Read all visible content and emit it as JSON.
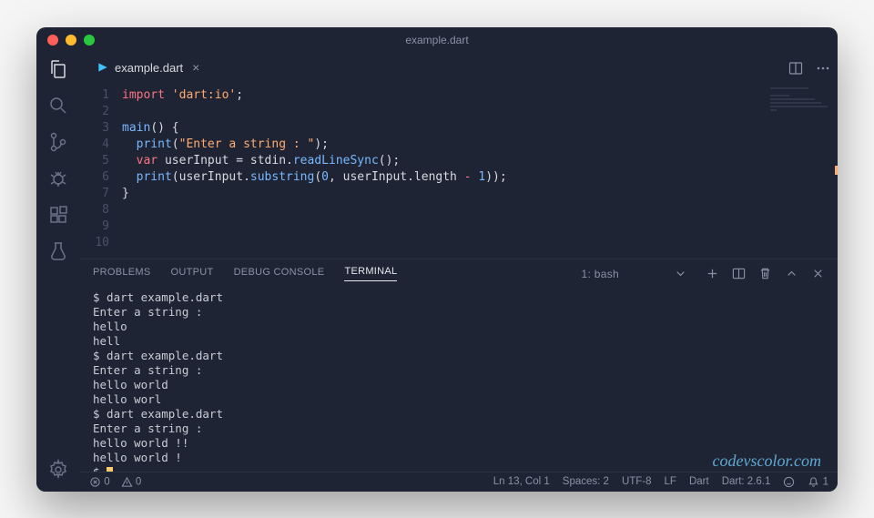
{
  "window": {
    "title": "example.dart"
  },
  "tab": {
    "filename": "example.dart"
  },
  "code": {
    "lines": [
      1,
      2,
      3,
      4,
      5,
      6,
      7,
      8,
      9,
      10
    ]
  },
  "panel": {
    "tabs": {
      "problems": "PROBLEMS",
      "output": "OUTPUT",
      "debug": "DEBUG CONSOLE",
      "terminal": "TERMINAL"
    },
    "select": "1: bash"
  },
  "terminal": {
    "lines": [
      "$ dart example.dart",
      "Enter a string :",
      "hello",
      "hell",
      "$ dart example.dart",
      "Enter a string :",
      "hello world",
      "hello worl",
      "$ dart example.dart",
      "Enter a string :",
      "hello world !!",
      "hello world !",
      "$ "
    ]
  },
  "status": {
    "errors": "0",
    "warnings": "0",
    "pos": "Ln 13, Col 1",
    "spaces": "Spaces: 2",
    "enc": "UTF-8",
    "eol": "LF",
    "lang": "Dart",
    "ver": "Dart: 2.6.1",
    "notif": "1"
  },
  "watermark": "codevscolor.com"
}
